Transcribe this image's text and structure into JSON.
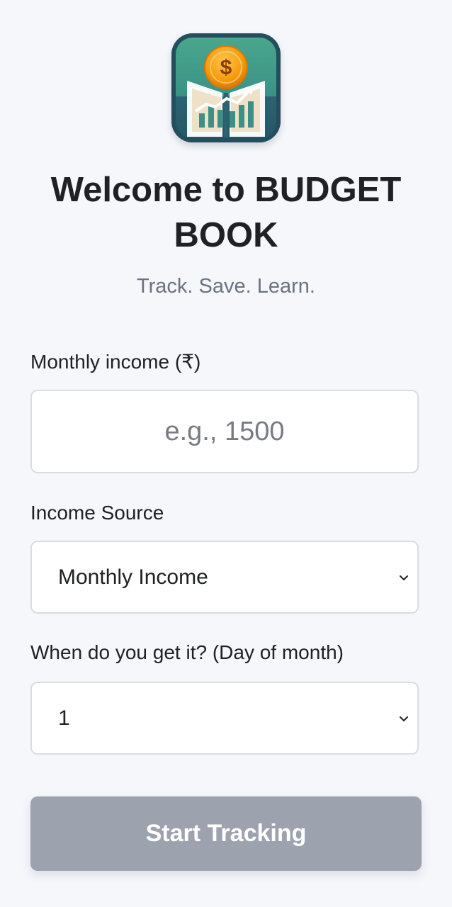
{
  "app": {
    "logo_icon": "budget-book-logo-icon",
    "title": "Welcome to BUDGET BOOK",
    "subtitle": "Track. Save. Learn."
  },
  "form": {
    "income": {
      "label": "Monthly income (₹)",
      "placeholder": "e.g., 1500",
      "value": ""
    },
    "source": {
      "label": "Income Source",
      "selected": "Monthly Income",
      "icon": "chevron-down-icon"
    },
    "day": {
      "label": "When do you get it? (Day of month)",
      "selected": "1",
      "icon": "chevron-down-icon"
    },
    "submit_label": "Start Tracking"
  },
  "colors": {
    "background": "#f5f7fb",
    "button": "#9ca3af",
    "button_text": "#ffffff",
    "logo_teal": "#2f5f6b",
    "coin": "#f59e0b"
  }
}
